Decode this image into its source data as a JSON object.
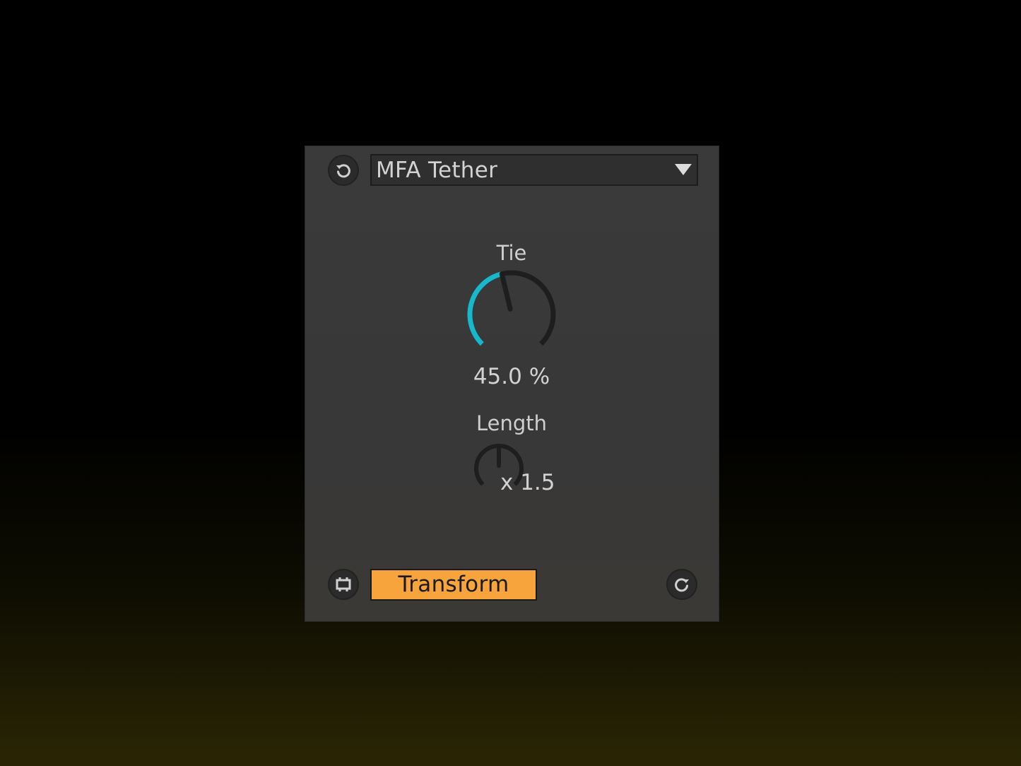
{
  "device": {
    "preset_name": "MFA Tether",
    "icons": {
      "preset": "rotate-ccw-icon",
      "dropdown": "triangle-down-icon",
      "map": "map-device-icon",
      "redo": "rotate-cw-icon"
    }
  },
  "tie": {
    "label": "Tie",
    "value_text": "45.0 %",
    "value": 0.45
  },
  "length": {
    "label": "Length",
    "value_text": "x 1.5",
    "value": 0.5
  },
  "actions": {
    "transform_label": "Transform"
  },
  "colors": {
    "accent_cyan": "#17b8cc",
    "transform_orange": "#f7a43c",
    "panel": "#3a3a3a"
  }
}
